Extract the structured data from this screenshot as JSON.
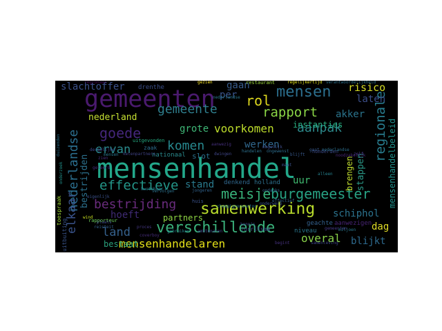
{
  "colors": {
    "background": "#000000",
    "page": "#ffffff"
  },
  "words": [
    {
      "text": "mensenhandel",
      "color": "#23a88a"
    },
    {
      "text": "gemeenten",
      "color": "#4a1a6e"
    },
    {
      "text": "samenwerking",
      "color": "#b9dc2c"
    },
    {
      "text": "mensen",
      "color": "#2c6f8e"
    },
    {
      "text": "verschillende",
      "color": "#3ab07a"
    },
    {
      "text": "burgemeester",
      "color": "#28a284"
    },
    {
      "text": "gemeente",
      "color": "#2f7f8e"
    },
    {
      "text": "rapport",
      "color": "#8bd646"
    },
    {
      "text": "rol",
      "color": "#ded81e"
    },
    {
      "text": "meisje",
      "color": "#38b27a"
    },
    {
      "text": "aanpak",
      "color": "#2d8a8c"
    },
    {
      "text": "goede",
      "color": "#44267a"
    },
    {
      "text": "effectieve",
      "color": "#24978a"
    },
    {
      "text": "bestrijding",
      "color": "#6a2c7e"
    },
    {
      "text": "komen",
      "color": "#27888e"
    },
    {
      "text": "voorkomen",
      "color": "#bede2c"
    },
    {
      "text": "mensenhandelaren",
      "color": "#e4e019"
    },
    {
      "text": "regionale",
      "color": "#287c8e"
    },
    {
      "text": "nederlandse",
      "color": "#2b6e8e"
    },
    {
      "text": "elkaar",
      "color": "#3a548c"
    },
    {
      "text": "land",
      "color": "#35618d"
    },
    {
      "text": "overal",
      "color": "#8ad44a"
    },
    {
      "text": "risico",
      "color": "#d6dc24"
    },
    {
      "text": "slachtoffer",
      "color": "#3b528b"
    },
    {
      "text": "nederland",
      "color": "#c6e032"
    },
    {
      "text": "ervan",
      "color": "#2a8a8d"
    },
    {
      "text": "werken",
      "color": "#31688e"
    },
    {
      "text": "grote",
      "color": "#3fb877"
    },
    {
      "text": "schiphol",
      "color": "#2c738e"
    },
    {
      "text": "blijkt",
      "color": "#2e6a8e"
    },
    {
      "text": "laten",
      "color": "#3c4f8a"
    },
    {
      "text": "akker",
      "color": "#2b758e"
    },
    {
      "text": "instanties",
      "color": "#28ae80"
    },
    {
      "text": "dag",
      "color": "#e1dd27"
    },
    {
      "text": "stappen",
      "color": "#2b9a89"
    },
    {
      "text": "brengen",
      "color": "#c1dd2f"
    },
    {
      "text": "hoeft",
      "color": "#3f2a74"
    },
    {
      "text": "partners",
      "color": "#8fd744"
    },
    {
      "text": "bestaat",
      "color": "#2aa07c"
    },
    {
      "text": "stand",
      "color": "#2a7b8e"
    },
    {
      "text": "uur",
      "color": "#41bd72"
    },
    {
      "text": "gaan",
      "color": "#385b8c"
    },
    {
      "text": "per",
      "color": "#3a548c"
    },
    {
      "text": "bestrijden",
      "color": "#2c718e"
    },
    {
      "text": "mensenhandelbeleid",
      "color": "#21918c"
    },
    {
      "text": "drenthe",
      "color": "#3c4f8a"
    },
    {
      "text": "slot",
      "color": "#2b728e"
    },
    {
      "text": "zaak",
      "color": "#2d6e8e"
    },
    {
      "text": "nationaal",
      "color": "#2a8a8d"
    },
    {
      "text": "jorritsma",
      "color": "#3e4a89"
    },
    {
      "text": "denkend",
      "color": "#31688e"
    },
    {
      "text": "holland",
      "color": "#2d708e"
    },
    {
      "text": "niveau",
      "color": "#2a778e"
    },
    {
      "text": "samenleving",
      "color": "#3f4788"
    },
    {
      "text": "toespraak",
      "color": "#a2da37"
    },
    {
      "text": "uitbuiting",
      "color": "#3a548c"
    },
    {
      "text": "uitgevonden",
      "color": "#25ab82"
    },
    {
      "text": "rapporteur",
      "color": "#6ccd5a"
    },
    {
      "text": "restaurant",
      "color": "#9dd93b"
    },
    {
      "text": "kwetsbaar",
      "color": "#287d8e"
    },
    {
      "text": "gezien",
      "color": "#fde725"
    },
    {
      "text": "geachte",
      "color": "#34618d"
    },
    {
      "text": "aanwezigen",
      "color": "#482475"
    },
    {
      "text": "honderden",
      "color": "#3e4c8a"
    },
    {
      "text": "gemeenten",
      "color": "#443983"
    },
    {
      "text": "begint",
      "color": "#46327e"
    },
    {
      "text": "nederlandse",
      "color": "#2d708e"
    },
    {
      "text": "vervolgen",
      "color": "#2c728e"
    },
    {
      "text": "jongeren",
      "color": "#32648e"
    },
    {
      "text": "dergelijke",
      "color": "#3f4889"
    },
    {
      "text": "mensen",
      "color": "#2a768e"
    },
    {
      "text": "geleerd",
      "color": "#472c7a"
    },
    {
      "text": "effectief",
      "color": "#32658e"
    },
    {
      "text": "champignonsector",
      "color": "#2a788e"
    },
    {
      "text": "huis",
      "color": "#3b528b"
    },
    {
      "text": "zien",
      "color": "#46327e"
    },
    {
      "text": "zelf",
      "color": "#443983"
    },
    {
      "text": "blijft",
      "color": "#38598c"
    },
    {
      "text": "reisteit",
      "color": "#34608d"
    },
    {
      "text": "plaats",
      "color": "#3e4989"
    },
    {
      "text": "coverboy",
      "color": "#472d7b"
    },
    {
      "text": "gebruiken",
      "color": "#25848e"
    },
    {
      "text": "proces",
      "color": "#453781"
    },
    {
      "text": "onderwerp",
      "color": "#3a538b"
    },
    {
      "text": "miljoen",
      "color": "#2a778e"
    },
    {
      "text": "handelen",
      "color": "#2d718e"
    },
    {
      "text": "ondanks",
      "color": "#33638d"
    },
    {
      "text": "ambtenaren",
      "color": "#40468a"
    },
    {
      "text": "dwingen",
      "color": "#404688"
    },
    {
      "text": "noodzakelijk",
      "color": "#482878"
    },
    {
      "text": "gaat",
      "color": "#38598c"
    },
    {
      "text": "mogelijk",
      "color": "#3e4c8a"
    },
    {
      "text": "ketenpartners",
      "color": "#414487"
    },
    {
      "text": "eigenlijk",
      "color": "#3b518b"
    },
    {
      "text": "ongewenst",
      "color": "#2e6e8e"
    },
    {
      "text": "aanwezig",
      "color": "#46307e"
    },
    {
      "text": "regelijkertijd",
      "color": "#e5e419"
    },
    {
      "text": "verantwoordelijkheid",
      "color": "#2c728e"
    },
    {
      "text": "duizenden",
      "color": "#2c728e"
    },
    {
      "text": "onderzoek",
      "color": "#21918c"
    },
    {
      "text": "nederlandse",
      "color": "#2a788e"
    },
    {
      "text": "wind",
      "color": "#c8e020"
    },
    {
      "text": "regionaal",
      "color": "#440154"
    },
    {
      "text": "kennis",
      "color": "#3e4a89"
    },
    {
      "text": "alleen",
      "color": "#26828e"
    },
    {
      "text": "maat",
      "color": "#3b528b"
    }
  ]
}
